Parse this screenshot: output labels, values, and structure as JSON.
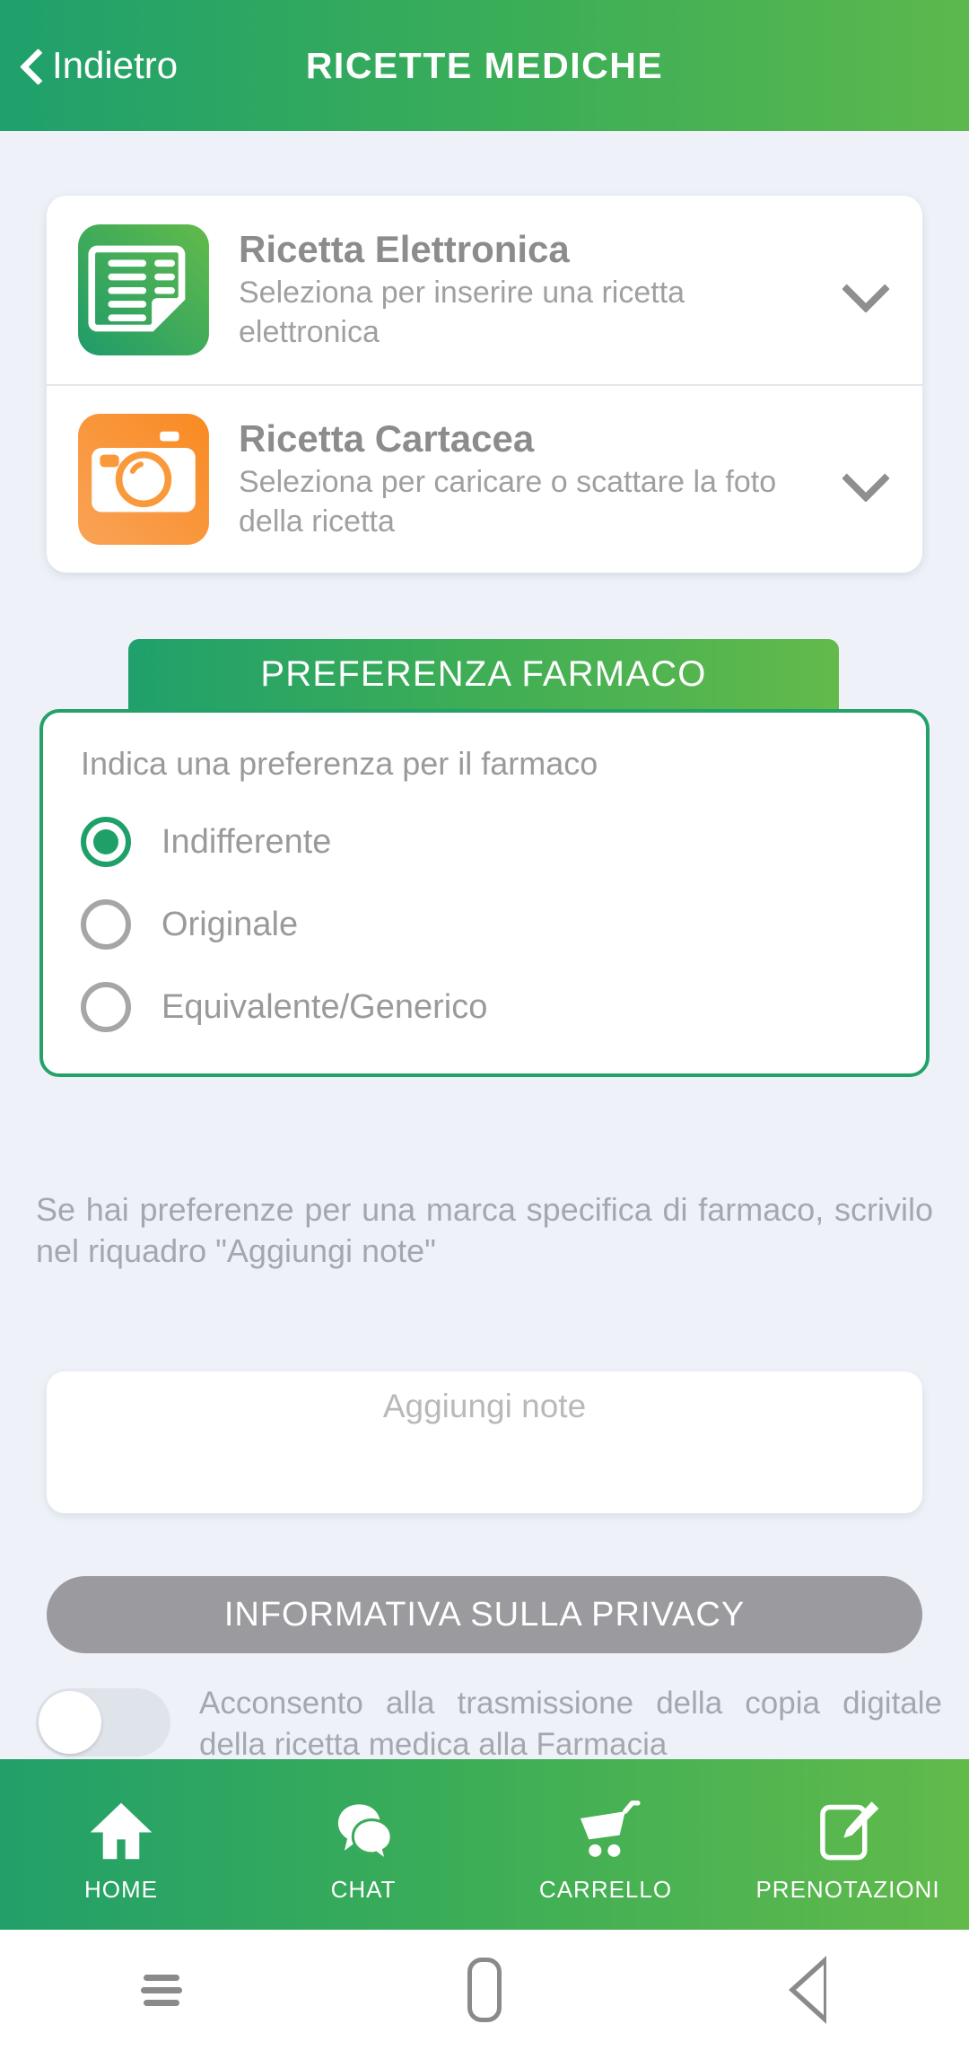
{
  "header": {
    "back_label": "Indietro",
    "title": "RICETTE MEDICHE",
    "gradient_start": "#1fa06c",
    "gradient_end": "#5cb84d"
  },
  "recipe_options": [
    {
      "icon": "document-icon",
      "title": "Ricetta Elettronica",
      "subtitle": "Seleziona per inserire una ricetta elettronica",
      "accent": "#3faa5a"
    },
    {
      "icon": "camera-icon",
      "title": "Ricetta Cartacea",
      "subtitle": "Seleziona per caricare o scattare la foto della ricetta",
      "accent": "#f99536"
    }
  ],
  "preference": {
    "tab_label": "PREFERENZA FARMACO",
    "lead": "Indica una preferenza per il farmaco",
    "options": [
      {
        "label": "Indifferente",
        "selected": true
      },
      {
        "label": "Originale",
        "selected": false
      },
      {
        "label": "Equivalente/Generico",
        "selected": false
      }
    ],
    "border_color": "#23a169"
  },
  "helper_text": "Se hai preferenze per una marca specifica di farmaco, scrivilo nel riquadro \"Aggiungi note\"",
  "note_field": {
    "placeholder": "Aggiungi note",
    "value": ""
  },
  "privacy_button": {
    "label": "INFORMATIVA SULLA PRIVACY",
    "color": "#9a9a9f"
  },
  "consent": {
    "toggle_state": "off",
    "text": "Acconsento alla trasmissione della copia digitale della ricetta medica alla Farmacia"
  },
  "bottom_nav": [
    {
      "icon": "home-icon",
      "label": "HOME"
    },
    {
      "icon": "chat-icon",
      "label": "CHAT"
    },
    {
      "icon": "cart-icon",
      "label": "CARRELLO"
    },
    {
      "icon": "bookings-icon",
      "label": "PRENOTAZIONI"
    }
  ],
  "system_nav": [
    {
      "icon": "recents-icon"
    },
    {
      "icon": "home-square-icon"
    },
    {
      "icon": "back-triangle-icon"
    }
  ]
}
